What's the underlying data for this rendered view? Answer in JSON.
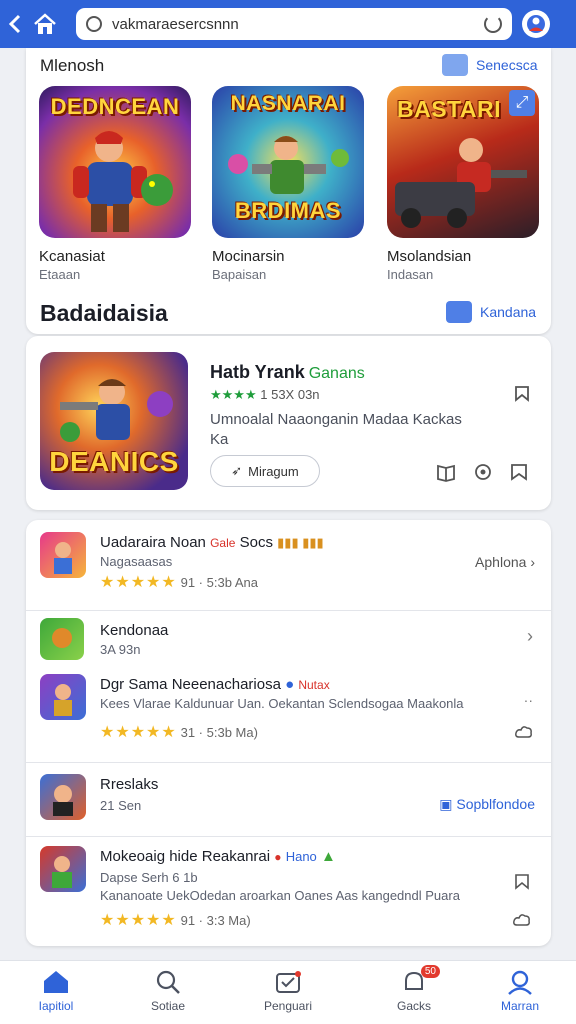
{
  "topbar": {
    "search_value": "vakmaraesercsnnn",
    "back_icon": "chevron-left-icon",
    "home_icon": "home-icon"
  },
  "featured": {
    "heading": "Mlenosh",
    "see_all": "Senecsca",
    "games": [
      {
        "art_title": "DEDNCEAN",
        "title": "Kcanasiat",
        "subtitle": "Etaaan"
      },
      {
        "art_title": "NASNARAI",
        "art_subtitle": "BRDIMAS",
        "title": "Mocinarsin",
        "subtitle": "Bapaisan"
      },
      {
        "art_title": "BASTARI",
        "title": "Msolandsian",
        "subtitle": "Indasan"
      }
    ],
    "section2_heading": "Badaidaisia",
    "section2_link": "Kandana"
  },
  "big_app": {
    "art_title": "DEANICS",
    "title": "Hatb Yrank",
    "title_tag": "Ganans",
    "rating_stars": "★★★★",
    "rating_text": "1 53X 03n",
    "desc1": "Umnoalal Naaonganin Madaa Kackas",
    "desc2": "Ka",
    "button": "Miragum"
  },
  "list": [
    {
      "title": "Uadaraira Noan",
      "tag_red": "Gale",
      "tag_text": "Socs",
      "subtitle": "Nagasaasas",
      "stars": "★★★★★",
      "rating": "91 · 5:3b Ana",
      "right_label": "Aphlona"
    },
    {
      "title": "Kendonaa",
      "subtitle": "3A 93n"
    },
    {
      "title": "Dgr Sama Neeenachariosa",
      "tag_red": "Nutax",
      "desc": "Kees Vlarae Kaldunuar Uan. Oekantan Sclendsogaa Maakonla",
      "stars": "★★★★★",
      "rating": "31 · 5:3b Ma)"
    },
    {
      "title": "Rreslaks",
      "subtitle": "21 Sen",
      "right_label": "Sopblfondoe"
    },
    {
      "title": "Mokeoaig hide Reakanrai",
      "tag_red": "Hano",
      "subtitle": "Dapse Serh 6 1b",
      "desc": "Kananoate UekOdedan aroarkan Oanes Aas kangedndl Puara",
      "stars": "★★★★★",
      "rating": "91 · 3:3 Ma)"
    }
  ],
  "bottomnav": [
    {
      "label": "Iapitiol"
    },
    {
      "label": "Sotiae"
    },
    {
      "label": "Penguari"
    },
    {
      "label": "Gacks",
      "badge": "50"
    },
    {
      "label": "Marran"
    }
  ]
}
